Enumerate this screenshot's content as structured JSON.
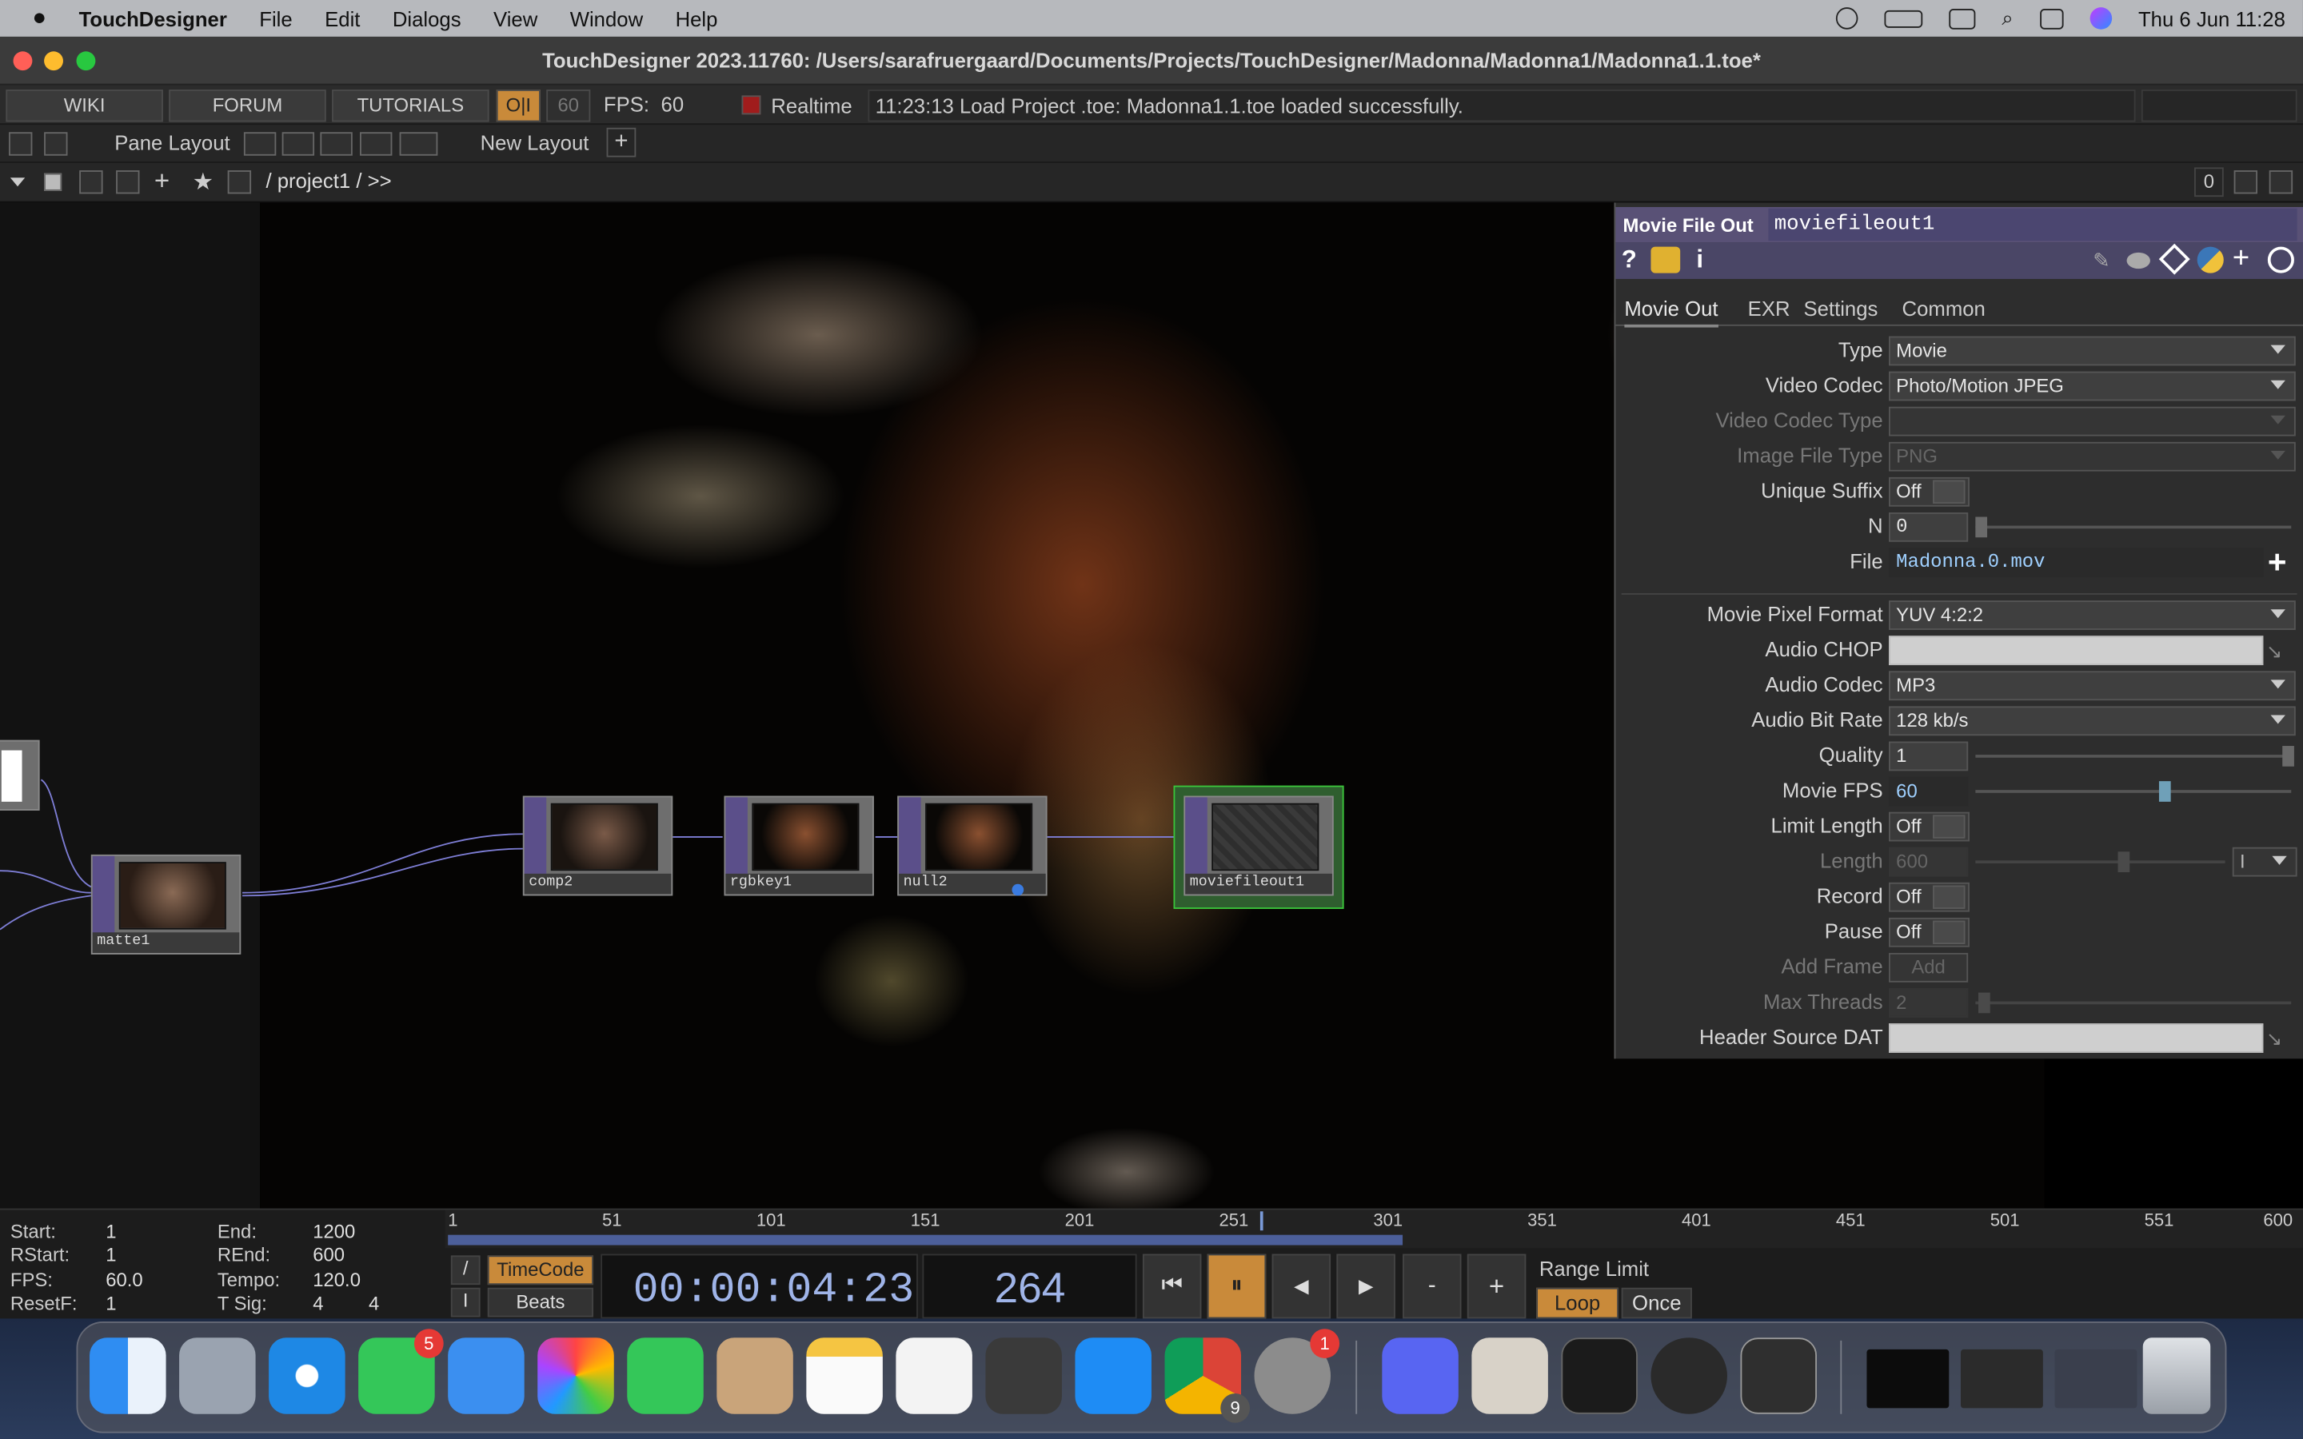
{
  "menubar": {
    "app": "TouchDesigner",
    "items": [
      "File",
      "Edit",
      "Dialogs",
      "View",
      "Window",
      "Help"
    ],
    "clock": "Thu 6 Jun  11:28"
  },
  "window": {
    "title": "TouchDesigner 2023.11760: /Users/sarafruergaard/Documents/Projects/TouchDesigner/Madonna/Madonna1/Madonna1.1.toe*"
  },
  "toolbar": {
    "wiki": "WIKI",
    "forum": "FORUM",
    "tutorials": "TUTORIALS",
    "oi": "O|I",
    "fps_cook": "60",
    "fps_label": "FPS:",
    "fps_value": "60",
    "realtime": "Realtime",
    "status": "11:23:13 Load Project .toe: Madonna1.1.toe loaded successfully."
  },
  "layout_bar": {
    "pane_layout": "Pane Layout",
    "new_layout": "New Layout",
    "plus": "+"
  },
  "path_bar": {
    "path": "/ project1 / >>",
    "counter": "0"
  },
  "nodes": {
    "matte": "matte1",
    "comp": "comp2",
    "rgbkey": "rgbkey1",
    "null": "null2",
    "moviefileout": "moviefileout1"
  },
  "params": {
    "op_type": "Movie File Out",
    "op_name": "moviefileout1",
    "tabs": [
      "Movie Out",
      "EXR",
      "Settings",
      "Common"
    ],
    "type_label": "Type",
    "type_value": "Movie",
    "video_codec_label": "Video Codec",
    "video_codec_value": "Photo/Motion JPEG",
    "video_codec_type_label": "Video Codec Type",
    "video_codec_type_value": "",
    "image_file_type_label": "Image File Type",
    "image_file_type_value": "PNG",
    "unique_suffix_label": "Unique Suffix",
    "unique_suffix_value": "Off",
    "n_label": "N",
    "n_value": "0",
    "file_label": "File",
    "file_value": "Madonna.0.mov",
    "pixel_format_label": "Movie Pixel Format",
    "pixel_format_value": "YUV 4:2:2",
    "audio_chop_label": "Audio CHOP",
    "audio_chop_value": "",
    "audio_codec_label": "Audio Codec",
    "audio_codec_value": "MP3",
    "audio_bitrate_label": "Audio Bit Rate",
    "audio_bitrate_value": "128 kb/s",
    "quality_label": "Quality",
    "quality_value": "1",
    "movie_fps_label": "Movie FPS",
    "movie_fps_value": "60",
    "limit_length_label": "Limit Length",
    "limit_length_value": "Off",
    "length_label": "Length",
    "length_value": "600",
    "length_unit": "I",
    "record_label": "Record",
    "record_value": "Off",
    "pause_label": "Pause",
    "pause_value": "Off",
    "add_frame_label": "Add Frame",
    "add_frame_value": "Add",
    "max_threads_label": "Max Threads",
    "max_threads_value": "2",
    "header_dat_label": "Header Source DAT",
    "header_dat_value": ""
  },
  "timeline": {
    "start_label": "Start:",
    "start": "1",
    "end_label": "End:",
    "end": "1200",
    "rstart_label": "RStart:",
    "rstart": "1",
    "rend_label": "REnd:",
    "rend": "600",
    "fps_label": "FPS:",
    "fps": "60.0",
    "tempo_label": "Tempo:",
    "tempo": "120.0",
    "resetf_label": "ResetF:",
    "resetf": "1",
    "tsig_label": "T Sig:",
    "tsig_a": "4",
    "tsig_b": "4",
    "ticks": [
      "1",
      "51",
      "101",
      "151",
      "201",
      "251",
      "301",
      "351",
      "401",
      "451",
      "501",
      "551",
      "600"
    ],
    "timecode_btn": "TimeCode",
    "beats_btn": "Beats",
    "timecode": "00:00:04:23",
    "frame": "264",
    "range_limit": "Range Limit",
    "loop": "Loop",
    "once": "Once",
    "minus": "-",
    "plus": "+",
    "slash": "/",
    "ibar": "I"
  },
  "dock": {
    "messages_badge": "5",
    "chrome_badge": "9",
    "settings_badge": "1"
  }
}
